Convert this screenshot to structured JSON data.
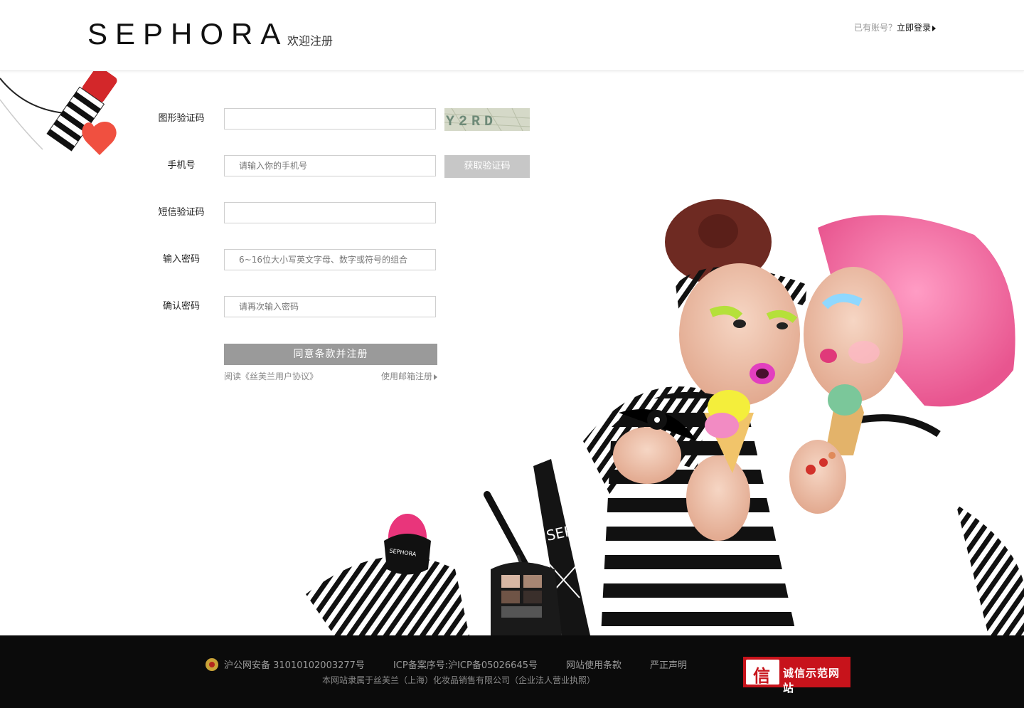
{
  "header": {
    "logo": "SEPHORA",
    "welcome": "欢迎注册",
    "has_account": "已有账号？",
    "login_link": "立即登录"
  },
  "form": {
    "captcha": {
      "label": "图形验证码",
      "value": "",
      "captcha_text": "Y2RD"
    },
    "phone": {
      "label": "手机号",
      "placeholder": "请输入你的手机号",
      "button": "获取验证码"
    },
    "sms": {
      "label": "短信验证码",
      "value": ""
    },
    "password": {
      "label": "输入密码",
      "placeholder": "6~16位大小写英文字母、数字或符号的组合"
    },
    "confirm": {
      "label": "确认密码",
      "placeholder": "请再次输入密码"
    },
    "submit": "同意条款并注册",
    "agreement_link": "阅读《丝芙兰用户协议》",
    "email_register": "使用邮箱注册"
  },
  "footer": {
    "police_record": "沪公网安备 31010102003277号",
    "icp": "ICP备案序号:沪ICP备05026645号",
    "terms": "网站使用条款",
    "statement": "严正声明",
    "copyright": "本网站隶属于丝芙兰（上海）化妆品销售有限公司（企业法人营业执照）",
    "trust_badge": "诚信示范网站",
    "trust_seal": "信"
  },
  "colors": {
    "submit_bg": "#9a9a9a",
    "sms_button_bg": "#c7c7c7",
    "footer_bg": "#0b0b0b",
    "trust_red": "#c7131b"
  }
}
